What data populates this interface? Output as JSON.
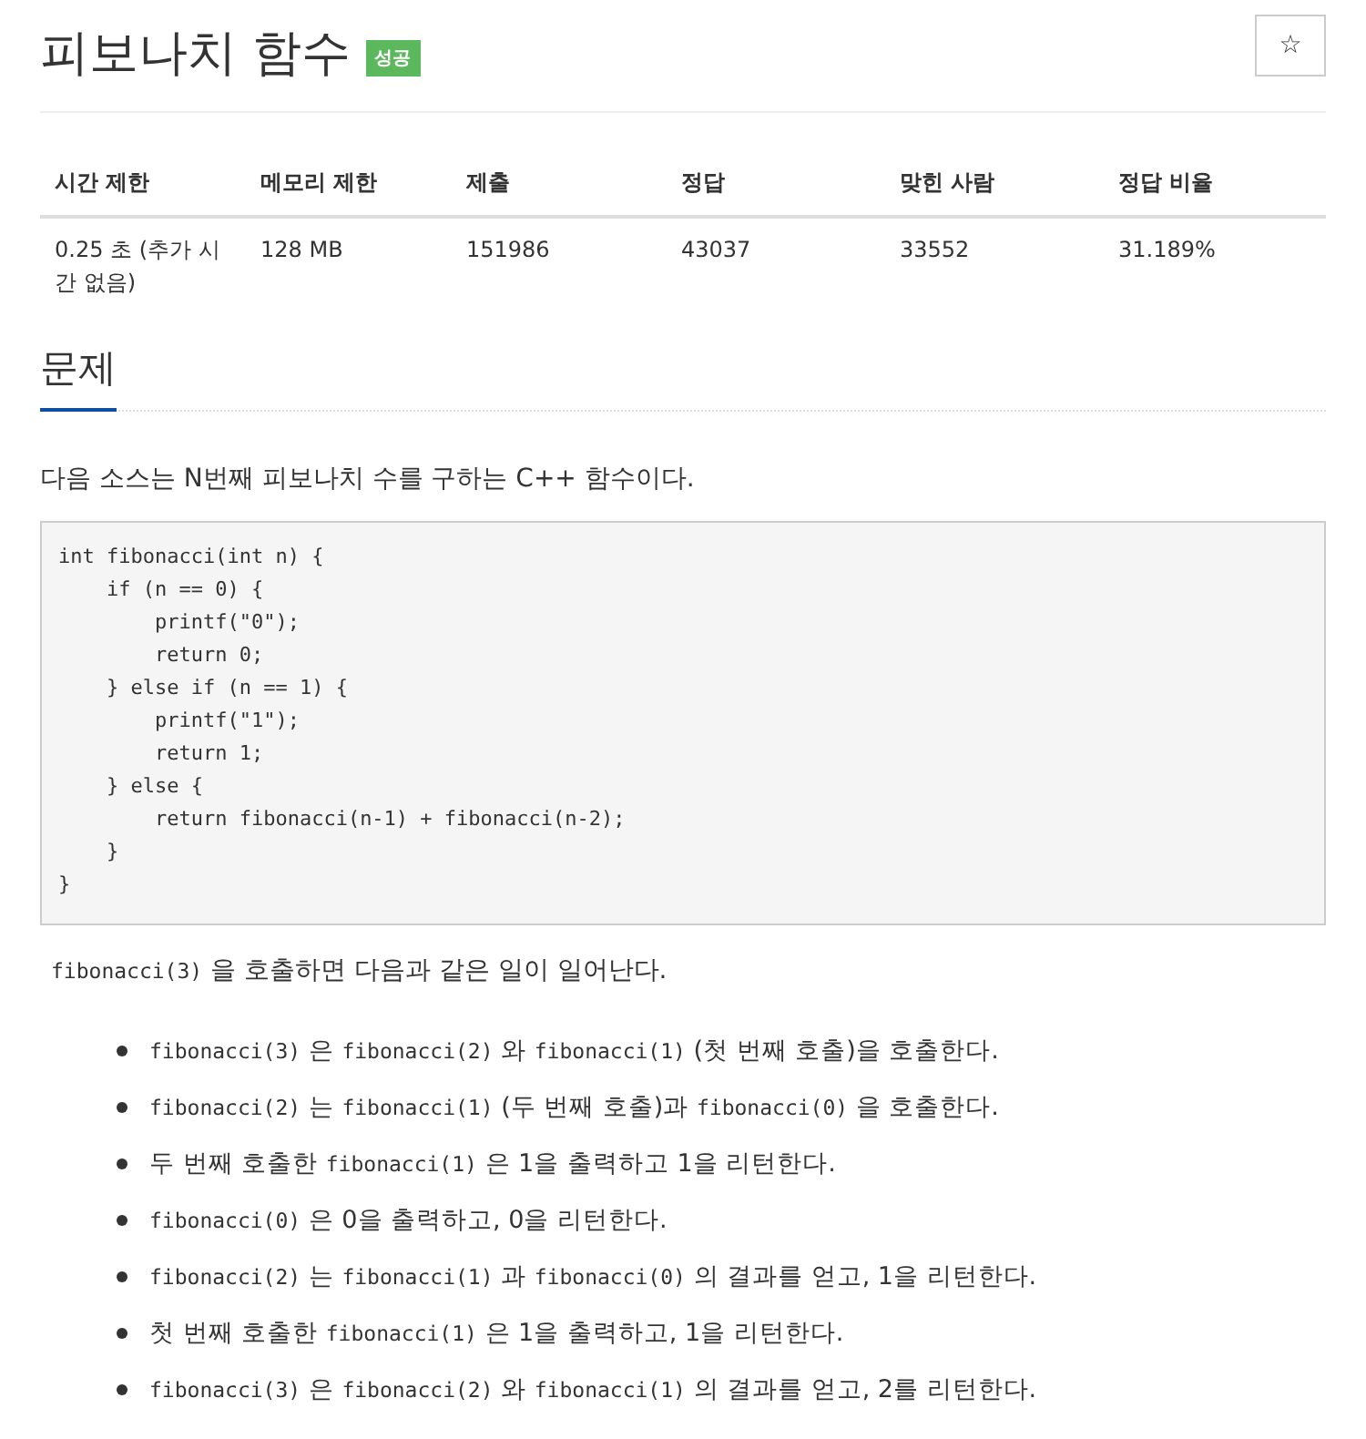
{
  "title": "피보나치 함수",
  "badge": {
    "label": "성공",
    "kind": "success"
  },
  "star_button": {
    "label": "☆"
  },
  "table": {
    "columns": [
      "시간 제한",
      "메모리 제한",
      "제출",
      "정답",
      "맞힌 사람",
      "정답 비율"
    ],
    "rows": [
      [
        "0.25 초 (추가 시간 없음)",
        "128 MB",
        "151986",
        "43037",
        "33552",
        "31.189%"
      ]
    ]
  },
  "section": {
    "heading": "문제",
    "intro": "다음 소스는 N번째 피보나치 수를 구하는 C++ 함수이다.",
    "code": "int fibonacci(int n) {\n    if (n == 0) {\n        printf(\"0\");\n        return 0;\n    } else if (n == 1) {\n        printf(\"1\");\n        return 1;\n    } else {\n        return fibonacci(n-1) + fibonacci(n-2);\n    }\n}",
    "lead": [
      {
        "kind": "code",
        "text": "fibonacci(3)"
      },
      {
        "kind": "text",
        "text": " 을 호출하면 다음과 같은 일이 일어난다."
      }
    ],
    "steps": [
      [
        {
          "kind": "code",
          "text": "fibonacci(3)"
        },
        {
          "kind": "text",
          "text": " 은 "
        },
        {
          "kind": "code",
          "text": "fibonacci(2)"
        },
        {
          "kind": "text",
          "text": " 와 "
        },
        {
          "kind": "code",
          "text": "fibonacci(1)"
        },
        {
          "kind": "text",
          "text": " (첫 번째 호출)을 호출한다."
        }
      ],
      [
        {
          "kind": "code",
          "text": "fibonacci(2)"
        },
        {
          "kind": "text",
          "text": " 는 "
        },
        {
          "kind": "code",
          "text": "fibonacci(1)"
        },
        {
          "kind": "text",
          "text": " (두 번째 호출)과 "
        },
        {
          "kind": "code",
          "text": "fibonacci(0)"
        },
        {
          "kind": "text",
          "text": " 을 호출한다."
        }
      ],
      [
        {
          "kind": "text",
          "text": "두 번째 호출한 "
        },
        {
          "kind": "code",
          "text": "fibonacci(1)"
        },
        {
          "kind": "text",
          "text": " 은 1을 출력하고 1을 리턴한다."
        }
      ],
      [
        {
          "kind": "code",
          "text": "fibonacci(0)"
        },
        {
          "kind": "text",
          "text": " 은 0을 출력하고, 0을 리턴한다."
        }
      ],
      [
        {
          "kind": "code",
          "text": "fibonacci(2)"
        },
        {
          "kind": "text",
          "text": " 는 "
        },
        {
          "kind": "code",
          "text": "fibonacci(1)"
        },
        {
          "kind": "text",
          "text": " 과 "
        },
        {
          "kind": "code",
          "text": "fibonacci(0)"
        },
        {
          "kind": "text",
          "text": " 의 결과를 얻고, 1을 리턴한다."
        }
      ],
      [
        {
          "kind": "text",
          "text": "첫 번째 호출한 "
        },
        {
          "kind": "code",
          "text": "fibonacci(1)"
        },
        {
          "kind": "text",
          "text": " 은 1을 출력하고, 1을 리턴한다."
        }
      ],
      [
        {
          "kind": "code",
          "text": "fibonacci(3)"
        },
        {
          "kind": "text",
          "text": " 은 "
        },
        {
          "kind": "code",
          "text": "fibonacci(2)"
        },
        {
          "kind": "text",
          "text": " 와 "
        },
        {
          "kind": "code",
          "text": "fibonacci(1)"
        },
        {
          "kind": "text",
          "text": " 의 결과를 얻고, 2를 리턴한다."
        }
      ]
    ]
  }
}
